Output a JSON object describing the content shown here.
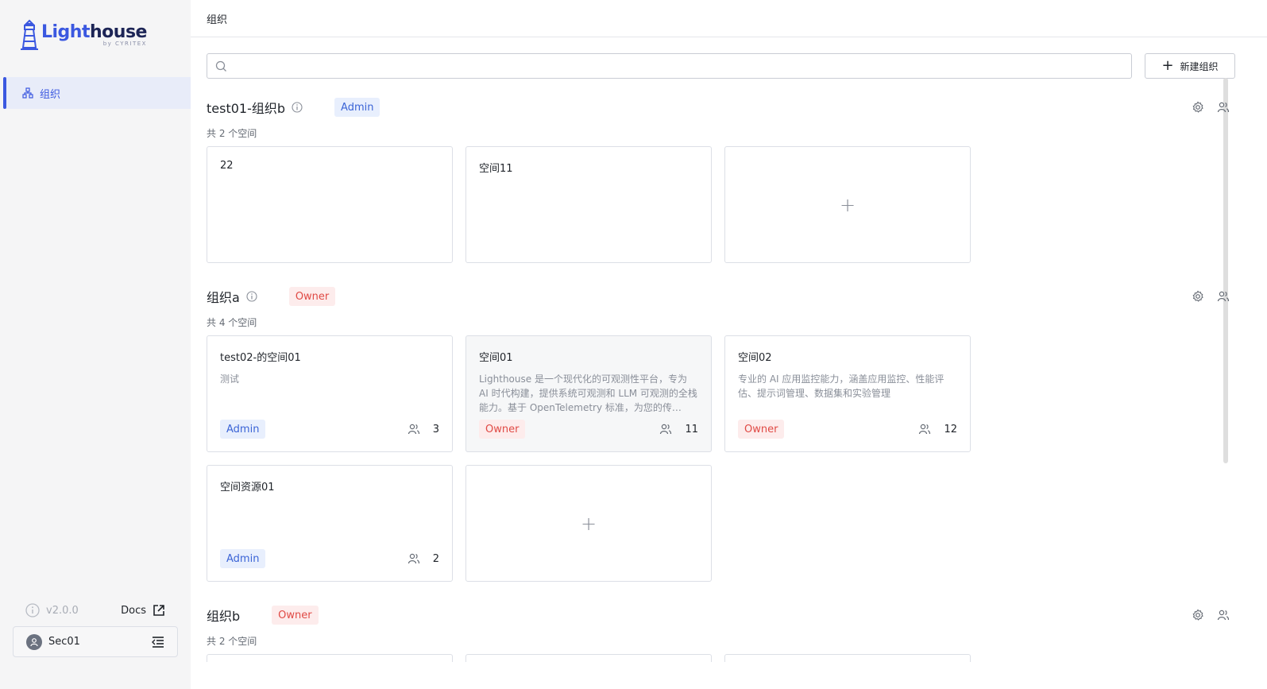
{
  "sidebar": {
    "logo": {
      "main_a": "Light",
      "main_b": "house",
      "sub": "by CYRITEX"
    },
    "nav": [
      {
        "label": "组织"
      }
    ],
    "version": "v2.0.0",
    "docs_label": "Docs",
    "user": {
      "name": "Sec01"
    }
  },
  "header": {
    "title": "组织"
  },
  "toolbar": {
    "search_placeholder": "",
    "new_org_label": "新建组织"
  },
  "orgs": [
    {
      "name": "test01-组织b",
      "role": "Admin",
      "count_label": "共 2 个空间",
      "spaces": [
        {
          "title": "22",
          "desc": ""
        },
        {
          "title": "空间11",
          "desc": ""
        }
      ]
    },
    {
      "name": "组织a",
      "role": "Owner",
      "count_label": "共 4 个空间",
      "spaces": [
        {
          "title": "test02-的空间01",
          "desc": "测试",
          "role": "Admin",
          "members": "3"
        },
        {
          "title": "空间01",
          "desc": "Lighthouse 是一个现代化的可观测性平台，专为 AI 时代构建，提供系统可观测和 LLM 可观测的全栈能力。基于 OpenTelemetry 标准，为您的传…",
          "role": "Owner",
          "members": "11"
        },
        {
          "title": "空间02",
          "desc": "专业的 AI 应用监控能力，涵盖应用监控、性能评估、提示词管理、数据集和实验管理",
          "role": "Owner",
          "members": "12"
        },
        {
          "title": "空间资源01",
          "desc": "",
          "role": "Admin",
          "members": "2"
        }
      ]
    },
    {
      "name": "组织b",
      "role": "Owner",
      "count_label": "共 2 个空间"
    }
  ],
  "colors": {
    "accent": "#3b58e0",
    "admin_bg": "#e8effd",
    "owner_bg": "#fdecec",
    "owner_text": "#e04a45"
  }
}
